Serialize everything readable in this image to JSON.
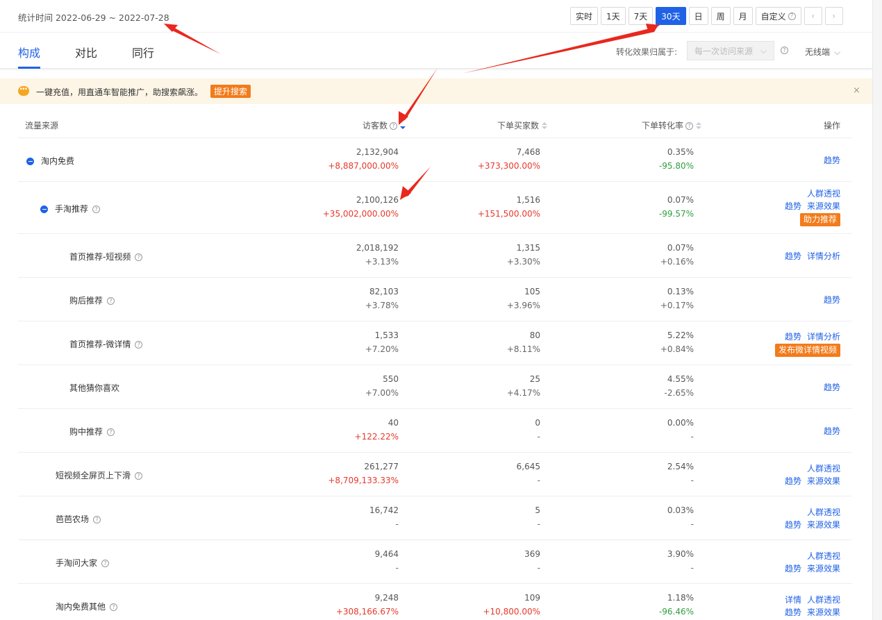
{
  "stat_time": "统计时间 2022-06-29 ~ 2022-07-28",
  "range_buttons": [
    "实时",
    "1天",
    "7天",
    "30天",
    "日",
    "周",
    "月",
    "自定义"
  ],
  "active_range": "30天",
  "nav": {
    "prev": "‹",
    "next": "›"
  },
  "tabs": [
    "构成",
    "对比",
    "同行"
  ],
  "attribution": {
    "label": "转化效果归属于:",
    "value": "每一次访问来源",
    "device": "无线端"
  },
  "banner": {
    "text": "一键充值，用直通车智能推广，助搜索飙涨。",
    "button": "提升搜索",
    "close": "×"
  },
  "table": {
    "headers": {
      "source": "流量来源",
      "visitors": "访客数",
      "buyers": "下单买家数",
      "conversion": "下单转化率",
      "ops": "操作"
    },
    "rows": [
      {
        "name": "淘内免费",
        "visitors": "2,132,904",
        "visitors_chg": "+8,887,000.00%",
        "buyers": "7,468",
        "buyers_chg": "+373,300.00%",
        "conv": "0.35%",
        "conv_chg": "-95.80%",
        "ops": [
          [
            "趋势"
          ]
        ]
      },
      {
        "name": "手淘推荐",
        "visitors": "2,100,126",
        "visitors_chg": "+35,002,000.00%",
        "buyers": "1,516",
        "buyers_chg": "+151,500.00%",
        "conv": "0.07%",
        "conv_chg": "-99.57%",
        "ops": [
          [
            "人群透视"
          ],
          [
            "趋势",
            "来源效果"
          ]
        ],
        "op_orange": "助力推荐"
      },
      {
        "name": "首页推荐-短视频",
        "visitors": "2,018,192",
        "visitors_chg": "+3.13%",
        "buyers": "1,315",
        "buyers_chg": "+3.30%",
        "conv": "0.07%",
        "conv_chg": "+0.16%",
        "ops": [
          [
            "趋势",
            "详情分析"
          ]
        ]
      },
      {
        "name": "购后推荐",
        "visitors": "82,103",
        "visitors_chg": "+3.78%",
        "buyers": "105",
        "buyers_chg": "+3.96%",
        "conv": "0.13%",
        "conv_chg": "+0.17%",
        "ops": [
          [
            "趋势"
          ]
        ]
      },
      {
        "name": "首页推荐-微详情",
        "visitors": "1,533",
        "visitors_chg": "+7.20%",
        "buyers": "80",
        "buyers_chg": "+8.11%",
        "conv": "5.22%",
        "conv_chg": "+0.84%",
        "ops": [
          [
            "趋势",
            "详情分析"
          ]
        ],
        "op_orange": "发布微详情视频"
      },
      {
        "name": "其他猜你喜欢",
        "visitors": "550",
        "visitors_chg": "+7.00%",
        "buyers": "25",
        "buyers_chg": "+4.17%",
        "conv": "4.55%",
        "conv_chg": "-2.65%",
        "ops": [
          [
            "趋势"
          ]
        ]
      },
      {
        "name": "购中推荐",
        "visitors": "40",
        "visitors_chg": "+122.22%",
        "buyers": "0",
        "buyers_chg": "-",
        "conv": "0.00%",
        "conv_chg": "-",
        "ops": [
          [
            "趋势"
          ]
        ]
      },
      {
        "name": "短视频全屏页上下滑",
        "visitors": "261,277",
        "visitors_chg": "+8,709,133.33%",
        "buyers": "6,645",
        "buyers_chg": "-",
        "conv": "2.54%",
        "conv_chg": "-",
        "ops": [
          [
            "人群透视"
          ],
          [
            "趋势",
            "来源效果"
          ]
        ]
      },
      {
        "name": "芭芭农场",
        "visitors": "16,742",
        "visitors_chg": "-",
        "buyers": "5",
        "buyers_chg": "-",
        "conv": "0.03%",
        "conv_chg": "-",
        "ops": [
          [
            "人群透视"
          ],
          [
            "趋势",
            "来源效果"
          ]
        ]
      },
      {
        "name": "手淘问大家",
        "visitors": "9,464",
        "visitors_chg": "-",
        "buyers": "369",
        "buyers_chg": "-",
        "conv": "3.90%",
        "conv_chg": "-",
        "ops": [
          [
            "人群透视"
          ],
          [
            "趋势",
            "来源效果"
          ]
        ]
      },
      {
        "name": "淘内免费其他",
        "visitors": "9,248",
        "visitors_chg": "+308,166.67%",
        "buyers": "109",
        "buyers_chg": "+10,800.00%",
        "conv": "1.18%",
        "conv_chg": "-96.46%",
        "ops": [
          [
            "详情",
            "人群透视"
          ],
          [
            "趋势",
            "来源效果"
          ]
        ]
      }
    ]
  },
  "colors": {
    "accent": "#2062e6",
    "up": "#e8382b",
    "down": "#2e9e3e",
    "orange": "#f27b1b",
    "annotation": "#e8281e"
  }
}
